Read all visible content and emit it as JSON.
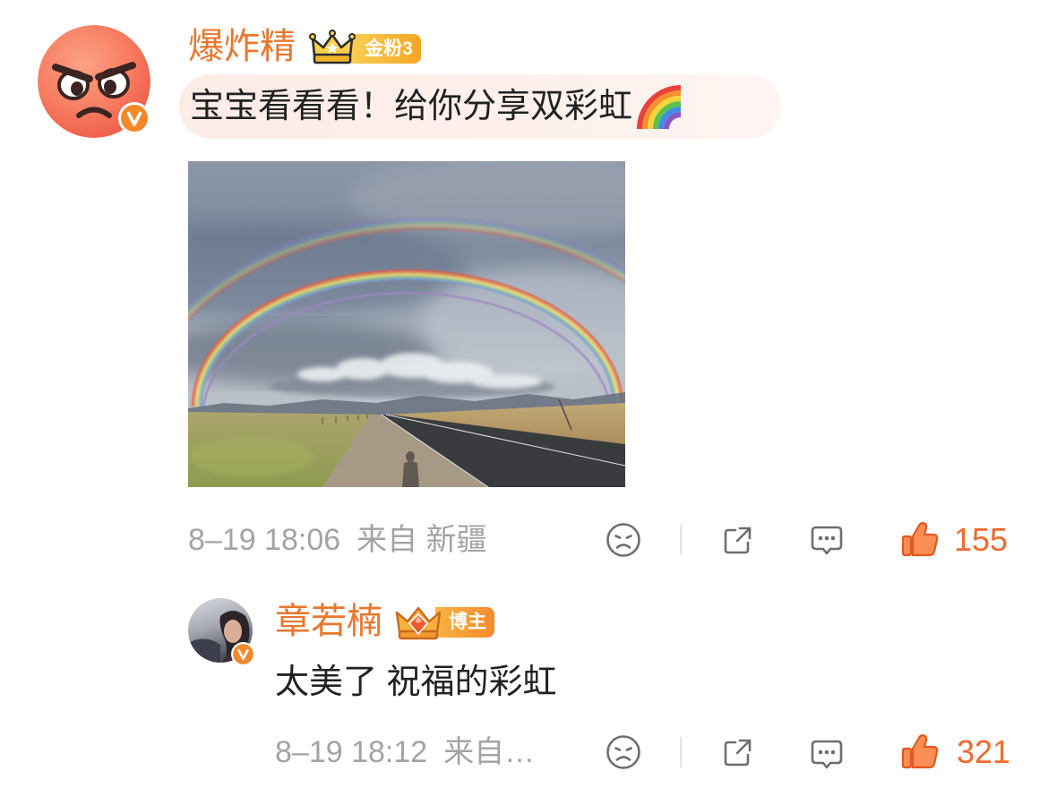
{
  "comment": {
    "username": "爆炸精",
    "fan_badge": {
      "icon": "crown-icon",
      "label": "金粉3"
    },
    "text": "宝宝看看看！给你分享双彩虹",
    "text_emoji": "rainbow-emoji-icon",
    "timestamp": "8–19 18:06",
    "source": "来自 新疆",
    "likes": "155"
  },
  "reply": {
    "username": "章若楠",
    "role_badge": {
      "icon": "crown-diamond-icon",
      "label": "博主"
    },
    "text": "太美了 祝福的彩虹",
    "timestamp": "8–19 18:12",
    "source": "来自…",
    "likes": "321"
  },
  "action_icons": [
    "sad-face-icon",
    "share-icon",
    "comment-icon",
    "thumbs-up-icon"
  ],
  "colors": {
    "username": "#e8772e",
    "like_count": "#ef6a2e",
    "meta_text": "#a3a3a3",
    "action_icon": "#6e6e6e",
    "verified_badge": "#f3872a",
    "fan_badge": "#f5a623",
    "role_badge": "#f58b2e"
  }
}
